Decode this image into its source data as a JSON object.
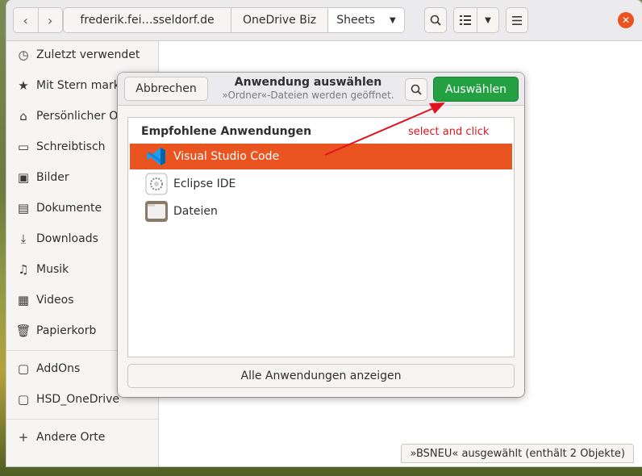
{
  "header": {
    "breadcrumbs": [
      "frederik.fei…sseldorf.de",
      "OneDrive Biz",
      "Sheets"
    ],
    "close_icon": "close-icon"
  },
  "sidebar": {
    "items": [
      {
        "label": "Zuletzt verwendet",
        "icon": "clock-icon"
      },
      {
        "label": "Mit Stern markiert",
        "icon": "star-icon"
      },
      {
        "label": "Persönlicher Ordner",
        "icon": "home-icon"
      },
      {
        "label": "Schreibtisch",
        "icon": "desktop-icon"
      },
      {
        "label": "Bilder",
        "icon": "pictures-icon"
      },
      {
        "label": "Dokumente",
        "icon": "documents-icon"
      },
      {
        "label": "Downloads",
        "icon": "download-icon"
      },
      {
        "label": "Musik",
        "icon": "music-icon"
      },
      {
        "label": "Videos",
        "icon": "videos-icon"
      },
      {
        "label": "Papierkorb",
        "icon": "trash-icon"
      }
    ],
    "bookmarks": [
      {
        "label": "AddOns",
        "icon": "folder-icon"
      },
      {
        "label": "HSD_OneDrive",
        "icon": "folder-icon"
      }
    ],
    "other_places": {
      "label": "Andere Orte",
      "icon": "plus-icon"
    }
  },
  "status": {
    "text": "»BSNEU« ausgewählt  (enthält 2 Objekte)"
  },
  "dialog": {
    "cancel_label": "Abbrechen",
    "title": "Anwendung auswählen",
    "subtitle": "»Ordner«-Dateien werden geöffnet.",
    "select_label": "Auswählen",
    "list_heading": "Empfohlene Anwendungen",
    "apps": [
      {
        "label": "Visual Studio Code",
        "icon": "vscode-icon",
        "selected": true
      },
      {
        "label": "Eclipse IDE",
        "icon": "eclipse-icon",
        "selected": false
      },
      {
        "label": "Dateien",
        "icon": "files-icon",
        "selected": false
      }
    ],
    "all_apps_label": "Alle Anwendungen anzeigen"
  },
  "annotation": {
    "text": "select and click",
    "color": "#e0141e"
  },
  "colors": {
    "accent": "#e95420",
    "select_button": "#22a042"
  }
}
